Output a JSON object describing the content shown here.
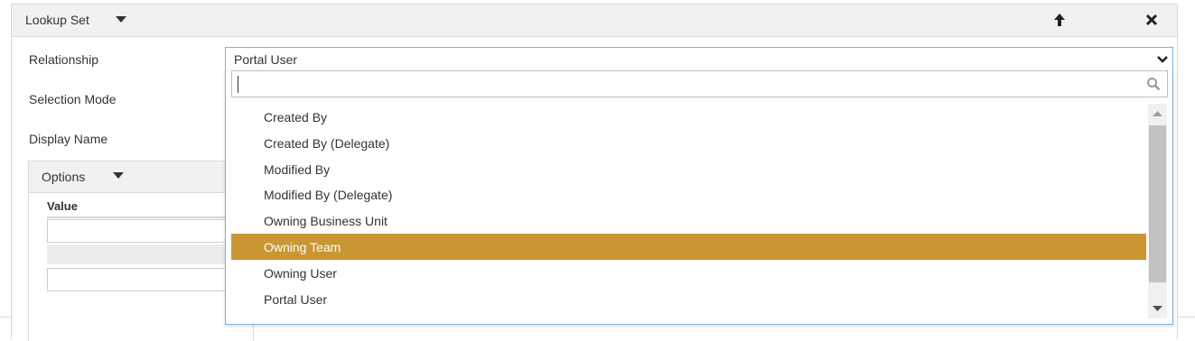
{
  "header": {
    "title": "Lookup Set"
  },
  "fields": {
    "relationship_label": "Relationship",
    "selection_mode_label": "Selection Mode",
    "display_name_label": "Display Name"
  },
  "options": {
    "title": "Options",
    "value_header": "Value"
  },
  "relationship_select": {
    "selected_value": "Portal User",
    "search_value": "",
    "items": [
      "Created By",
      "Created By (Delegate)",
      "Modified By",
      "Modified By (Delegate)",
      "Owning Business Unit",
      "Owning Team",
      "Owning User",
      "Portal User"
    ],
    "highlighted_item": "Owning Team"
  },
  "colors": {
    "highlight": "#c89632",
    "focus_border": "#7fb1d8",
    "header_bg": "#f2f1f1"
  },
  "icons": [
    "chevron-down-icon",
    "arrow-up-icon",
    "close-icon",
    "search-icon",
    "scroll-up-icon",
    "scroll-down-icon"
  ]
}
